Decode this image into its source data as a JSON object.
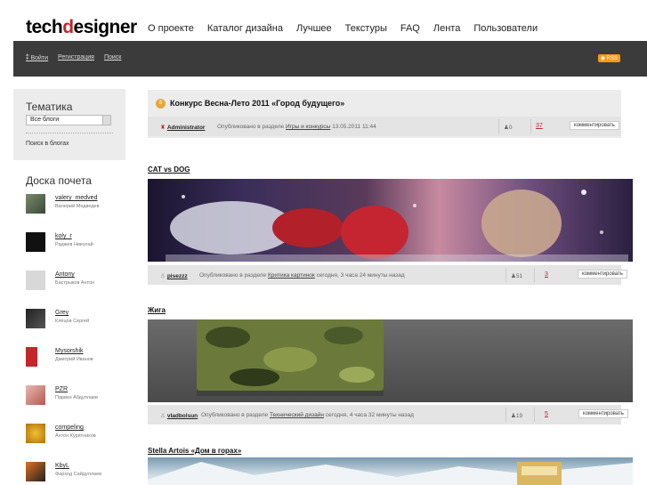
{
  "logo": {
    "part1": "tech",
    "part2": "d",
    "part3": "esigner"
  },
  "nav": [
    "О проекте",
    "Каталог дизайна",
    "Лучшее",
    "Текстуры",
    "FAQ",
    "Лента",
    "Пользователи"
  ],
  "userbar": {
    "login": "Войти",
    "register": "Регистрация",
    "search": "Поиск",
    "rss": "RSS"
  },
  "sidebar": {
    "topic_title": "Тематика",
    "select_value": "Все блоги",
    "search_link": "Поиск в блогах",
    "honor_title": "Доска почета",
    "users": [
      {
        "nick": "valery_medved",
        "name": "Валерий Медведев"
      },
      {
        "nick": "koly_r",
        "name": "Раджев Николай"
      },
      {
        "nick": "Antony",
        "name": "Бастрыков Антон"
      },
      {
        "nick": "Grey",
        "name": "Клёцов Сергей"
      },
      {
        "nick": "Mysorshik",
        "name": "Дмитрий Иванов"
      },
      {
        "nick": "PZR",
        "name": "Парвиз Абдуллаев"
      },
      {
        "nick": "compeling",
        "name": "Антон Курятников"
      },
      {
        "nick": "KbyL",
        "name": "Фарход Сайдуллаев"
      }
    ]
  },
  "posts": [
    {
      "title": "Конкурс Весна-Лето 2011 «Город будущего»",
      "badge": "8",
      "author": "Administrator",
      "published_prefix": "Опубликовано в разделе",
      "section": "Игры и конкурсы",
      "time": "13.05.2011 11:44",
      "votes": "0",
      "comments": "37",
      "comment_btn": "комментировать"
    },
    {
      "title": "CAT vs DOG",
      "author": "pisezzz",
      "published_prefix": "Опубликовано в разделе",
      "section": "Критика картинок",
      "time": "сегодня, 3 часа 24 минуты назад",
      "votes": "51",
      "comments": "3",
      "comment_btn": "комментировать"
    },
    {
      "title": "Жига",
      "author": "vladbolsun",
      "published_prefix": "Опубликовано в разделе",
      "section": "Технический дизайн",
      "time": "сегодня, 4 часа 32 минуты назад",
      "votes": "19",
      "comments": "5",
      "comment_btn": "комментировать"
    },
    {
      "title": "Stella Artois «Дом в горах»"
    }
  ],
  "colors": {
    "accent": "#c4262a",
    "dark_bar": "#3b3b3b",
    "panel": "#ececec"
  }
}
